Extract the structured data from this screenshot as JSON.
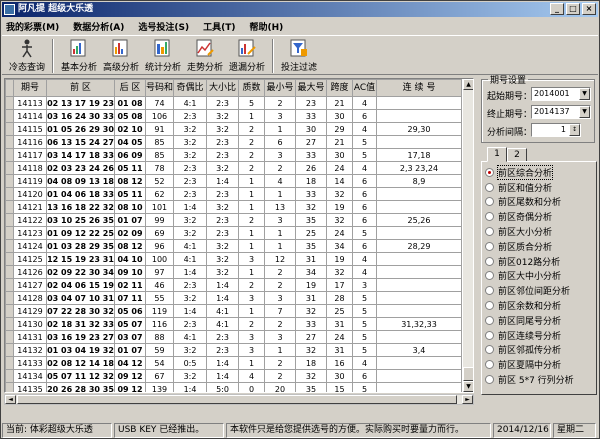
{
  "window": {
    "title": "阿凡提 超级大乐透"
  },
  "menu": [
    "我的彩票(M)",
    "数据分析(A)",
    "选号投注(S)",
    "工具(T)",
    "帮助(H)"
  ],
  "toolbar": [
    {
      "label": "冷态查询",
      "icon": "figure-icon"
    },
    {
      "label": "基本分析",
      "icon": "basic-analysis-icon"
    },
    {
      "label": "高级分析",
      "icon": "advanced-analysis-icon"
    },
    {
      "label": "统计分析",
      "icon": "statistics-icon"
    },
    {
      "label": "走势分析",
      "icon": "trend-icon"
    },
    {
      "label": "遗漏分析",
      "icon": "omission-icon"
    },
    {
      "label": "投注过滤",
      "icon": "filter-icon"
    }
  ],
  "table": {
    "columns": [
      "期号",
      "前 区",
      "后 区",
      "号码和",
      "奇偶比",
      "大小比",
      "质数",
      "最小号",
      "最大号",
      "跨度",
      "AC值",
      "连 续 号"
    ],
    "rows": [
      [
        "14113",
        "02 13 17 19 23",
        "01 08",
        "74",
        "4:1",
        "2:3",
        "5",
        "2",
        "23",
        "21",
        "4",
        ""
      ],
      [
        "14114",
        "03 16 24 30 33",
        "05 08",
        "106",
        "2:3",
        "3:2",
        "1",
        "3",
        "33",
        "30",
        "6",
        ""
      ],
      [
        "14115",
        "01 05 26 29 30",
        "02 10",
        "91",
        "3:2",
        "3:2",
        "2",
        "1",
        "30",
        "29",
        "4",
        "29,30"
      ],
      [
        "14116",
        "06 13 15 24 27",
        "04 05",
        "85",
        "3:2",
        "2:3",
        "2",
        "6",
        "27",
        "21",
        "5",
        ""
      ],
      [
        "14117",
        "03 14 17 18 33",
        "06 09",
        "85",
        "3:2",
        "2:3",
        "2",
        "3",
        "33",
        "30",
        "5",
        "17,18"
      ],
      [
        "14118",
        "02 03 23 24 26",
        "05 11",
        "78",
        "2:3",
        "3:2",
        "2",
        "2",
        "26",
        "24",
        "4",
        "2,3 23,24"
      ],
      [
        "14119",
        "04 08 09 13 18",
        "08 12",
        "52",
        "2:3",
        "1:4",
        "1",
        "4",
        "18",
        "14",
        "6",
        "8,9"
      ],
      [
        "14120",
        "01 04 06 18 33",
        "05 11",
        "62",
        "2:3",
        "2:3",
        "1",
        "1",
        "33",
        "32",
        "6",
        ""
      ],
      [
        "14121",
        "13 16 18 22 32",
        "08 10",
        "101",
        "1:4",
        "3:2",
        "1",
        "13",
        "32",
        "19",
        "6",
        ""
      ],
      [
        "14122",
        "03 10 25 26 35",
        "01 07",
        "99",
        "3:2",
        "2:3",
        "2",
        "3",
        "35",
        "32",
        "6",
        "25,26"
      ],
      [
        "14123",
        "01 09 12 22 25",
        "02 09",
        "69",
        "3:2",
        "2:3",
        "1",
        "1",
        "25",
        "24",
        "5",
        ""
      ],
      [
        "14124",
        "01 03 28 29 35",
        "08 12",
        "96",
        "4:1",
        "3:2",
        "1",
        "1",
        "35",
        "34",
        "6",
        "28,29"
      ],
      [
        "14125",
        "12 15 19 23 31",
        "04 10",
        "100",
        "4:1",
        "3:2",
        "3",
        "12",
        "31",
        "19",
        "4",
        ""
      ],
      [
        "14126",
        "02 09 22 30 34",
        "09 10",
        "97",
        "1:4",
        "3:2",
        "1",
        "2",
        "34",
        "32",
        "4",
        ""
      ],
      [
        "14127",
        "02 04 06 15 19",
        "02 11",
        "46",
        "2:3",
        "1:4",
        "2",
        "2",
        "19",
        "17",
        "3",
        ""
      ],
      [
        "14128",
        "03 04 07 10 31",
        "07 11",
        "55",
        "3:2",
        "1:4",
        "3",
        "3",
        "31",
        "28",
        "5",
        ""
      ],
      [
        "14129",
        "07 22 28 30 32",
        "05 06",
        "119",
        "1:4",
        "4:1",
        "1",
        "7",
        "32",
        "25",
        "5",
        ""
      ],
      [
        "14130",
        "02 18 31 32 33",
        "05 07",
        "116",
        "2:3",
        "4:1",
        "2",
        "2",
        "33",
        "31",
        "5",
        "31,32,33"
      ],
      [
        "14131",
        "03 16 19 23 27",
        "03 07",
        "88",
        "4:1",
        "2:3",
        "3",
        "3",
        "27",
        "24",
        "5",
        ""
      ],
      [
        "14132",
        "01 03 04 19 32",
        "01 07",
        "59",
        "3:2",
        "2:3",
        "3",
        "1",
        "32",
        "31",
        "5",
        "3,4"
      ],
      [
        "14133",
        "02 08 12 14 18",
        "04 12",
        "54",
        "0:5",
        "1:4",
        "1",
        "2",
        "18",
        "16",
        "4",
        ""
      ],
      [
        "14134",
        "05 07 11 12 32",
        "09 12",
        "67",
        "3:2",
        "1:4",
        "4",
        "2",
        "32",
        "30",
        "6",
        ""
      ],
      [
        "14135",
        "20 26 28 30 35",
        "09 12",
        "139",
        "1:4",
        "5:0",
        "0",
        "20",
        "35",
        "15",
        "5",
        ""
      ],
      [
        "14136",
        "04 18 20 34 35",
        "07 11",
        "111",
        "1:4",
        "4:1",
        "0",
        "4",
        "35",
        "31",
        "4",
        "34,35"
      ],
      [
        "14137",
        "02 11 16 22 34",
        "02 05",
        "85",
        "1:4",
        "2:3",
        "2",
        "2",
        "34",
        "32",
        "4",
        ""
      ]
    ]
  },
  "period_settings": {
    "legend": "期号设置",
    "start_label": "起始期号：",
    "start_value": "2014001",
    "end_label": "终止期号：",
    "end_value": "2014137",
    "interval_label": "分析间隔：",
    "interval_value": "1"
  },
  "tabs": [
    "1",
    "2"
  ],
  "analysis_options": [
    "前区综合分析",
    "前区和值分析",
    "前区尾数和分析",
    "前区奇偶分析",
    "前区大小分析",
    "前区质合分析",
    "前区012路分析",
    "前区大中小分析",
    "前区邻位间距分析",
    "前区余数和分析",
    "前区同尾号分析",
    "前区连续号分析",
    "前区邻孤传分析",
    "前区夏隔中分析",
    "前区 5*7 行列分析"
  ],
  "selected_option": 0,
  "status": {
    "current": "当前: 体彩超级大乐透",
    "usbkey": "USB KEY 已经推出。",
    "notice": "本软件只是给您提供选号的方便。实际购买时要量力而行。",
    "date": "2014/12/16",
    "weekday": "星期二"
  },
  "colors": {
    "title_start": "#0a246a",
    "title_end": "#a6caf0",
    "radio_selected": "#c00000"
  }
}
